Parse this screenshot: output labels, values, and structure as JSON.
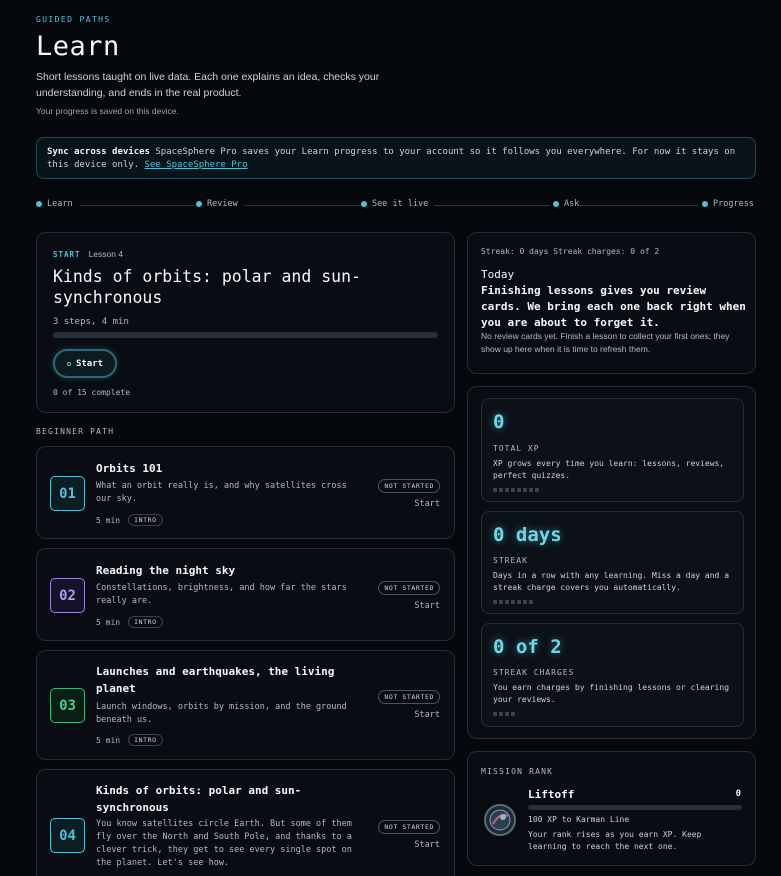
{
  "header": {
    "eyebrow": "GUIDED PATHS",
    "title": "Learn",
    "lede": "Short lessons taught on live data. Each one explains an idea, checks your understanding, and ends in the real product.",
    "saved_note": "Your progress is saved on this device."
  },
  "sync_banner": {
    "strong": "Sync across devices",
    "text": " SpaceSphere Pro saves your Learn progress to your account so it follows you everywhere. For now it stays on this device only. ",
    "link": "See SpaceSphere Pro"
  },
  "stepper": [
    "Learn",
    "Review",
    "See it live",
    "Ask",
    "Progress"
  ],
  "hero": {
    "tag": "START",
    "lesson": "Lesson 4",
    "title": "Kinds of orbits: polar and sun-synchronous",
    "meta": "3 steps, 4 min",
    "progress": 0,
    "button": "Start",
    "complete": "0 of 15 complete"
  },
  "path_label": "BEGINNER PATH",
  "lessons": [
    {
      "num": "01",
      "title": "Orbits 101",
      "desc": "What an orbit really is, and why satellites cross our sky.",
      "time": "5 min",
      "chip": "INTRO",
      "status": "NOT STARTED",
      "action": "Start"
    },
    {
      "num": "02",
      "title": "Reading the night sky",
      "desc": "Constellations, brightness, and how far the stars really are.",
      "time": "5 min",
      "chip": "INTRO",
      "status": "NOT STARTED",
      "action": "Start"
    },
    {
      "num": "03",
      "title": "Launches and earthquakes, the living planet",
      "desc": "Launch windows, orbits by mission, and the ground beneath us.",
      "time": "5 min",
      "chip": "INTRO",
      "status": "NOT STARTED",
      "action": "Start"
    },
    {
      "num": "04",
      "title": "Kinds of orbits: polar and sun-synchronous",
      "desc": "You know satellites circle Earth. But some of them fly over the North and South Pole, and thanks to a clever trick, they get to see every single spot on the planet. Let's see how.",
      "time": "",
      "chip": "",
      "status": "NOT STARTED",
      "action": "Start"
    }
  ],
  "review": {
    "streak_line": "Streak: 0 days   Streak charges: 0 of 2",
    "today": "Today",
    "lead": "Finishing lessons gives you review cards. We bring each one back right when you are about to forget it.",
    "note": "No review cards yet. Finish a lesson to collect your first ones; they show up here when it is time to refresh them."
  },
  "stats": [
    {
      "big": "0",
      "label": "TOTAL XP",
      "text": "XP grows every time you learn: lessons, reviews, perfect quizzes."
    },
    {
      "big": "0 days",
      "label": "STREAK",
      "text": "Days in a row with any learning. Miss a day and a streak charge covers you automatically."
    },
    {
      "big": "0 of 2",
      "label": "STREAK CHARGES",
      "text": "You earn charges by finishing lessons or clearing your reviews."
    }
  ],
  "rank": {
    "label": "MISSION RANK",
    "name": "Liftoff",
    "xp": "0",
    "next": "100 XP to Karman Line",
    "text": "Your rank rises as you earn XP. Keep learning to reach the next one.",
    "progress": 0
  },
  "colors": {
    "accent": "#4fc3d6",
    "purple": "#b19cf0",
    "green": "#3fd18a",
    "background": "#05080d"
  }
}
